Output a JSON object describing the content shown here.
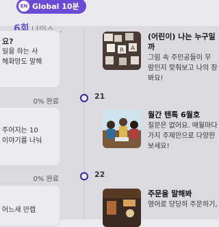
{
  "header": {
    "lang_badge": "EN",
    "pill_label": "Global 10분",
    "episode": "6회",
    "episode_sub": "나의스..."
  },
  "left": {
    "cards": [
      {
        "q": "요?",
        "line1": "일을 하는 사",
        "line2": "헤화망도 말해"
      },
      {
        "q": "",
        "line1": "주어지는 10",
        "line2": "이야기를 나눠"
      },
      {
        "q": "",
        "line1": "어느새 만렙",
        "line2": ""
      }
    ],
    "progress": [
      "0% 완료",
      "0% 완료"
    ]
  },
  "timeline": {
    "days": [
      "21",
      "22"
    ]
  },
  "right": {
    "cards": [
      {
        "title": "(어린이) 나는 누구일까",
        "line1": "그림 속 주인공들이 무",
        "line2": "람인지 맞춰보고 나의 장",
        "line3": "봐요!"
      },
      {
        "title": "월간 텐톡 6월호",
        "line1": "질문은 없어요. 매월마다",
        "line2": "가지 주제만으로 다양한",
        "line3": "보세요!"
      },
      {
        "title": "주문을 말해봐",
        "line1": "영어로 당당히 주문하기,",
        "line2": "",
        "line3": ""
      }
    ]
  },
  "colors": {
    "accent": "#6b4bd6",
    "timeline_dot": "#2a2aa0"
  }
}
